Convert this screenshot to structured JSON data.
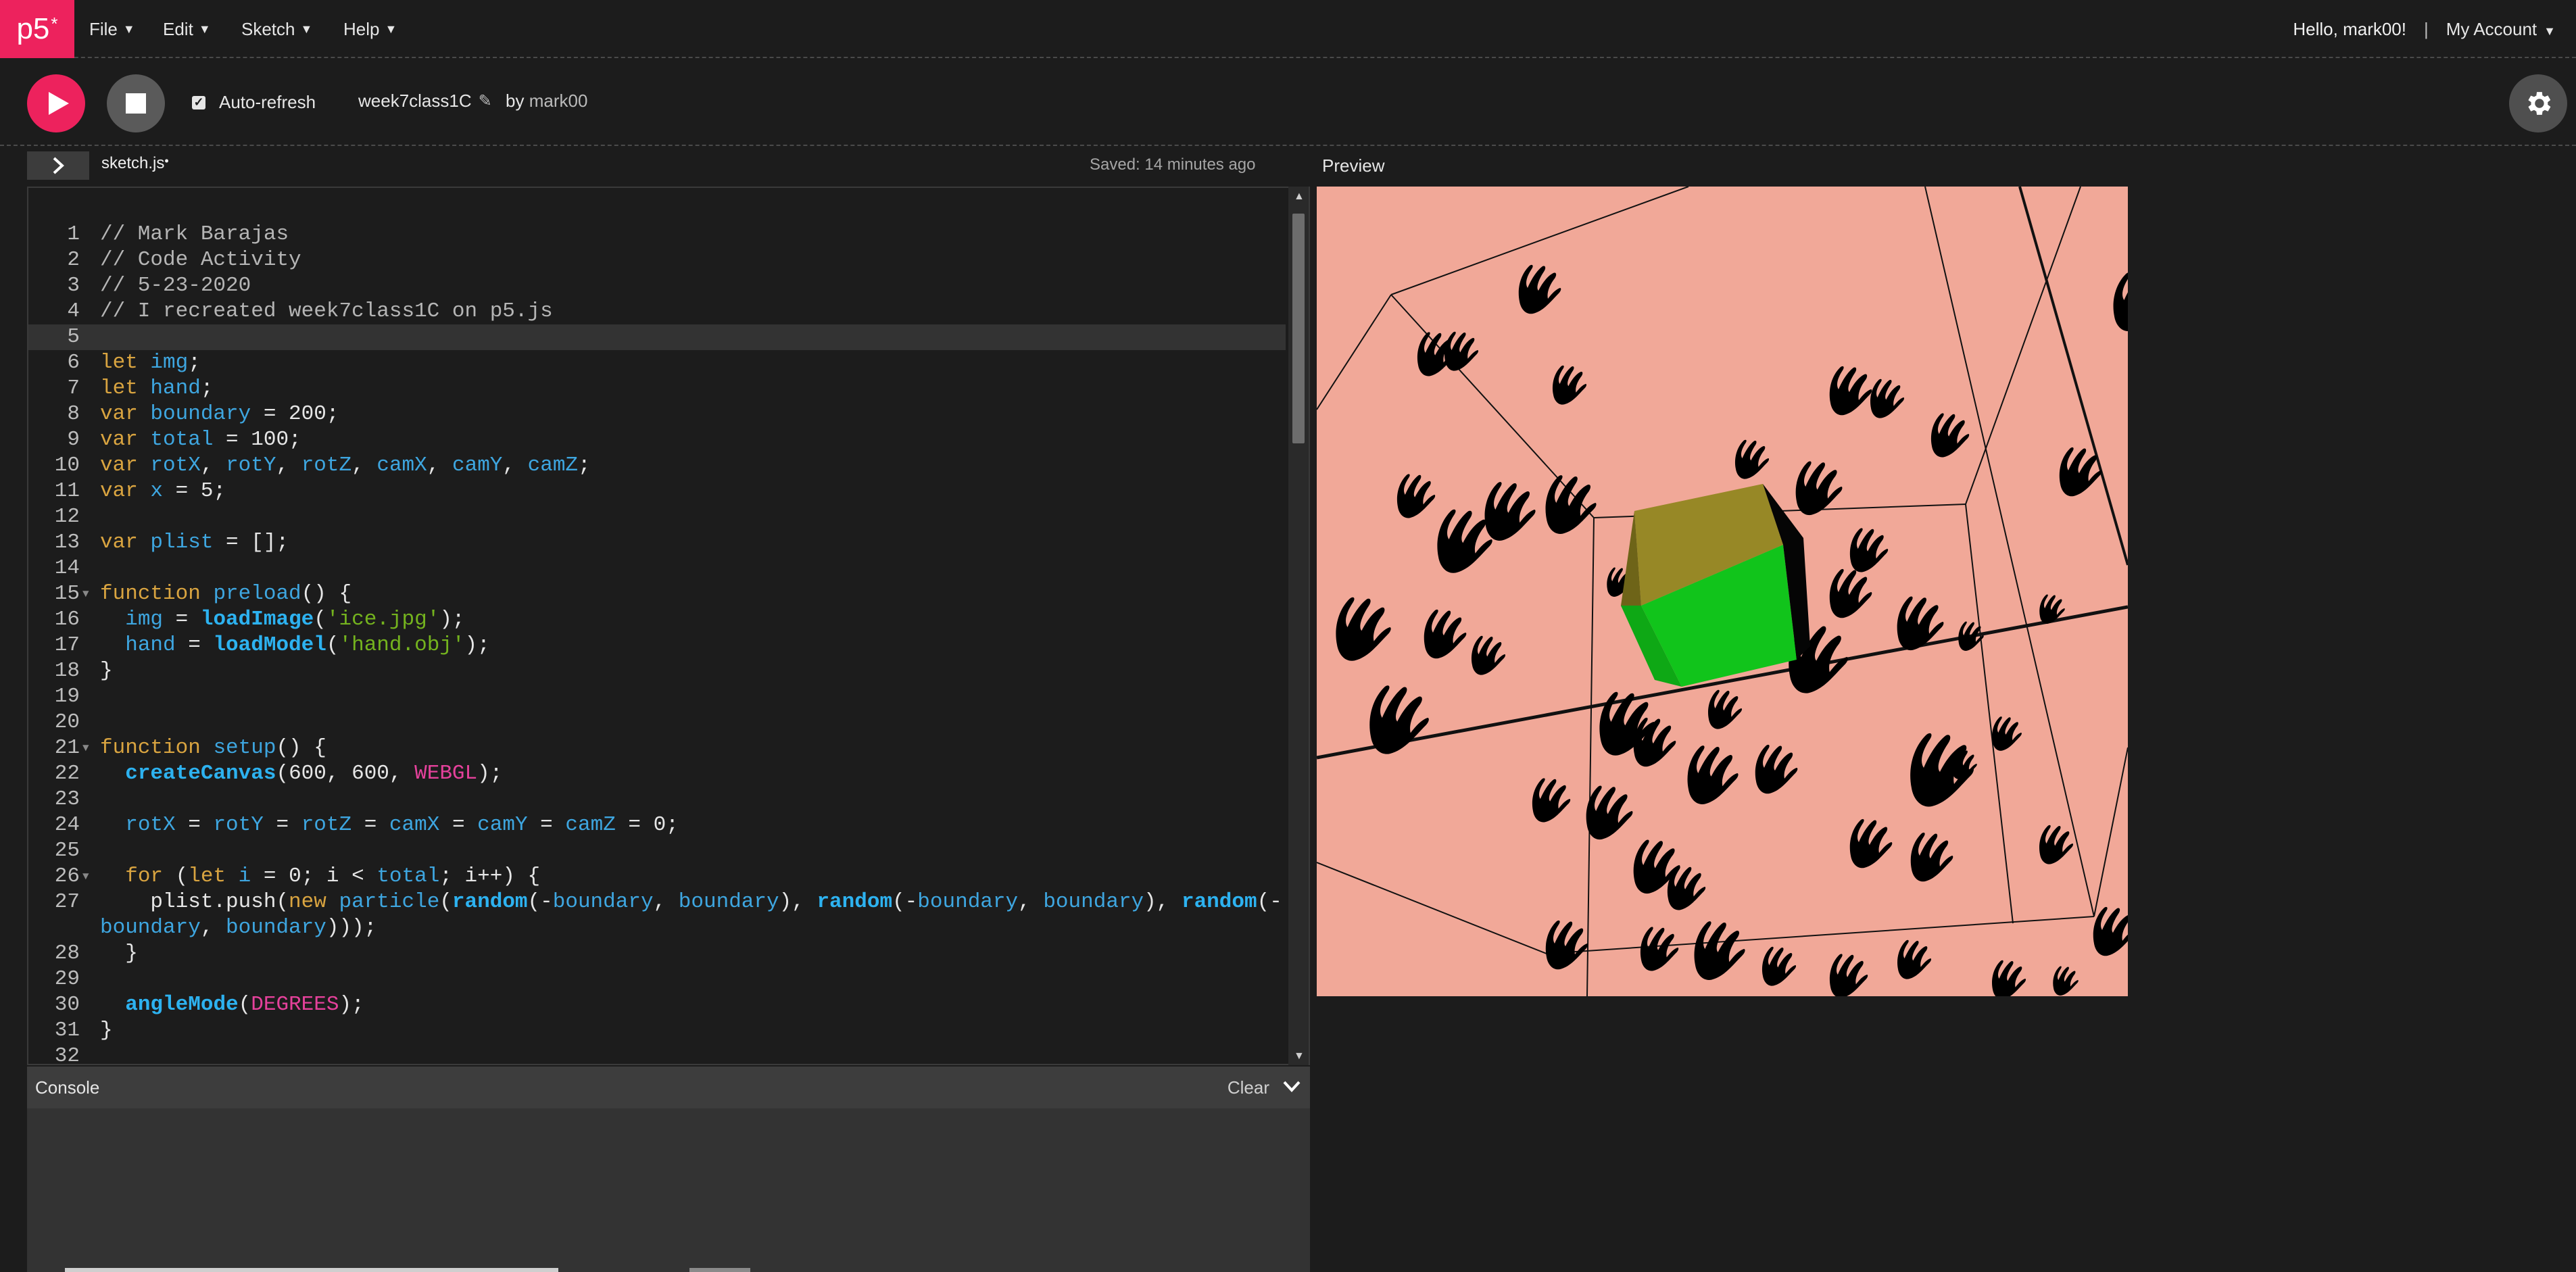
{
  "nav": {
    "logo": "p5",
    "logo_sup": "*",
    "menus": [
      "File",
      "Edit",
      "Sketch",
      "Help"
    ],
    "greeting": "Hello, mark00!",
    "separator": "|",
    "account": "My Account"
  },
  "toolbar": {
    "auto_refresh_label": "Auto-refresh",
    "auto_refresh_checked": true,
    "sketch_name": "week7class1C",
    "by_label": "by",
    "author": "mark00"
  },
  "editor": {
    "file_name": "sketch.js",
    "unsaved_marker": "•",
    "saved_status": "Saved: 14 minutes ago",
    "preview_label": "Preview",
    "active_line": 5,
    "lines": [
      {
        "n": "1",
        "html": "<span class='cm'>// Mark Barajas</span>"
      },
      {
        "n": "2",
        "html": "<span class='cm'>// Code Activity</span>"
      },
      {
        "n": "3",
        "html": "<span class='cm'>// 5-23-2020</span>"
      },
      {
        "n": "4",
        "html": "<span class='cm'>// I recreated week7class1C on p5.js</span>"
      },
      {
        "n": "5",
        "html": ""
      },
      {
        "n": "6",
        "html": "<span class='kw'>let</span> <span class='vr'>img</span>;"
      },
      {
        "n": "7",
        "html": "<span class='kw'>let</span> <span class='vr'>hand</span>;"
      },
      {
        "n": "8",
        "html": "<span class='kw'>var</span> <span class='vr'>boundary</span> = 200;"
      },
      {
        "n": "9",
        "html": "<span class='kw'>var</span> <span class='vr'>total</span> = 100;"
      },
      {
        "n": "10",
        "html": "<span class='kw'>var</span> <span class='vr'>rotX</span>, <span class='vr'>rotY</span>, <span class='vr'>rotZ</span>, <span class='vr'>camX</span>, <span class='vr'>camY</span>, <span class='vr'>camZ</span>;"
      },
      {
        "n": "11",
        "html": "<span class='kw'>var</span> <span class='vr'>x</span> = 5;"
      },
      {
        "n": "12",
        "html": ""
      },
      {
        "n": "13",
        "html": "<span class='kw'>var</span> <span class='vr'>plist</span> = [];"
      },
      {
        "n": "14",
        "html": ""
      },
      {
        "n": "15",
        "fold": true,
        "html": "<span class='kw'>function</span> <span class='fn'>preload</span>() {"
      },
      {
        "n": "16",
        "html": "  <span class='vr'>img</span> = <span class='fnb'>loadImage</span>(<span class='st'>'ice.jpg'</span>);"
      },
      {
        "n": "17",
        "html": "  <span class='vr'>hand</span> = <span class='fnb'>loadModel</span>(<span class='st'>'hand.obj'</span>);"
      },
      {
        "n": "18",
        "html": "}"
      },
      {
        "n": "19",
        "html": ""
      },
      {
        "n": "20",
        "html": ""
      },
      {
        "n": "21",
        "fold": true,
        "html": "<span class='kw'>function</span> <span class='fn'>setup</span>() {"
      },
      {
        "n": "22",
        "html": "  <span class='fnb'>createCanvas</span>(600, 600, <span class='cs'>WEBGL</span>);"
      },
      {
        "n": "23",
        "html": ""
      },
      {
        "n": "24",
        "html": "  <span class='vr'>rotX</span> = <span class='vr'>rotY</span> = <span class='vr'>rotZ</span> = <span class='vr'>camX</span> = <span class='vr'>camY</span> = <span class='vr'>camZ</span> = 0;"
      },
      {
        "n": "25",
        "html": ""
      },
      {
        "n": "26",
        "fold": true,
        "html": "  <span class='kw'>for</span> (<span class='kw'>let</span> <span class='vr'>i</span> = 0; i &lt; <span class='vr'>total</span>; i++) {"
      },
      {
        "n": "27",
        "html": "    plist.push(<span class='kw'>new</span> <span class='vr'>particle</span>(<span class='fnb'>random</span>(-<span class='vr'>boundary</span>, <span class='vr'>boundary</span>), <span class='fnb'>random</span>(-<span class='vr'>boundary</span>, <span class='vr'>boundary</span>), <span class='fnb'>random</span>(-"
      },
      {
        "n": "",
        "html": "<span class='vr'>boundary</span>, <span class='vr'>boundary</span>)));"
      },
      {
        "n": "28",
        "html": "  }"
      },
      {
        "n": "29",
        "html": ""
      },
      {
        "n": "30",
        "html": "  <span class='fnb'>angleMode</span>(<span class='cs'>DEGREES</span>);"
      },
      {
        "n": "31",
        "html": "}"
      },
      {
        "n": "32",
        "html": ""
      }
    ]
  },
  "console": {
    "title": "Console",
    "clear_label": "Clear"
  },
  "colors": {
    "accent": "#ed225d",
    "preview_bg": "#f1a898"
  }
}
